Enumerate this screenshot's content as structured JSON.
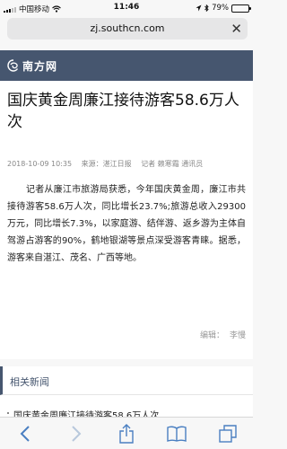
{
  "status": {
    "carrier": "中国移动",
    "time": "11:46",
    "battery": "79%",
    "battery_level": 0.79
  },
  "browser": {
    "url": "zj.southcn.com"
  },
  "site": {
    "name": "南方网"
  },
  "article": {
    "title": "国庆黄金周廉江接待游客58.6万人次",
    "date": "2018-10-09 10:35",
    "source": "来源：湛江日报",
    "author": "记者 赖寒霜 通讯员",
    "body": "记者从廉江市旅游局获悉，今年国庆黄金周，廉江市共接待游客58.6万人次，同比增长23.7%;旅游总收入29300万元，同比增长7.3%，以家庭游、结伴游、返乡游为主体自驾游占游客的90%，鹤地银湖等景点深受游客青睐。据悉，游客来自湛江、茂名、广西等地。",
    "editor_label": "编辑：",
    "editor_name": "李慢"
  },
  "related": {
    "heading": "相关新闻",
    "items": [
      {
        "label": "国庆黄金周廉江接待游客58.6万人次"
      }
    ]
  },
  "toolbar": {
    "icons": [
      "back-icon",
      "forward-icon",
      "share-icon",
      "bookmarks-icon",
      "tabs-icon"
    ]
  },
  "colors": {
    "header": "#46566f",
    "link": "#4a7fc1"
  }
}
